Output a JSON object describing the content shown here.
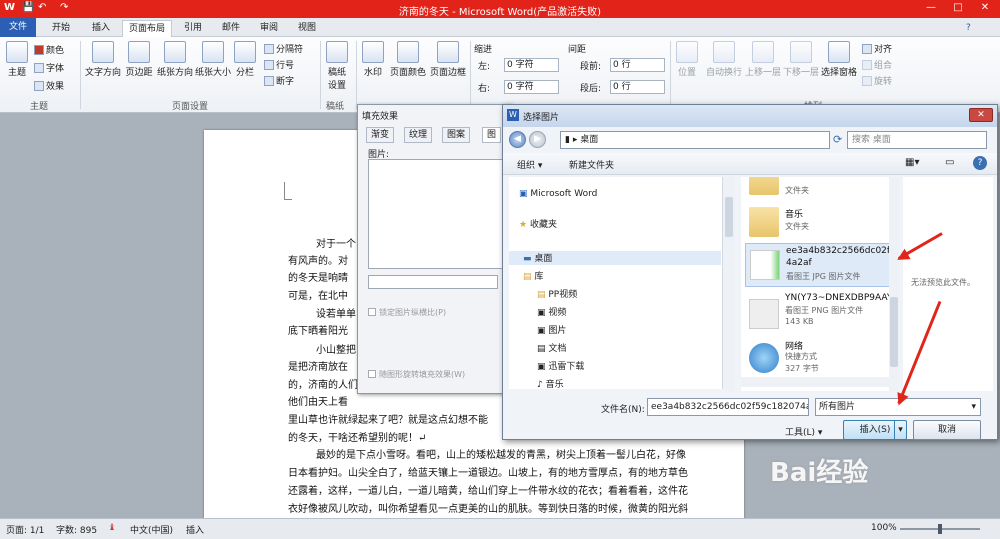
{
  "app": {
    "title": "济南的冬天 - Microsoft Word(产品激活失败)",
    "quick_access": [
      "W",
      "💾",
      "↶",
      "↷"
    ],
    "window_controls": [
      "—",
      "□",
      "✕"
    ],
    "help": "?"
  },
  "tabs": [
    "文件",
    "开始",
    "插入",
    "页面布局",
    "引用",
    "邮件",
    "审阅",
    "视图"
  ],
  "ribbon": {
    "theme": {
      "main": "主题",
      "colors": "颜色",
      "fonts": "字体",
      "effects": "效果",
      "group": "主题"
    },
    "page_setup": {
      "buttons": [
        "文字方向",
        "页边距",
        "纸张方向",
        "纸张大小",
        "分栏"
      ],
      "breaks": "分隔符",
      "line_numbers": "行号",
      "hyphenation": "断字",
      "group": "页面设置"
    },
    "draft": {
      "button": "稿纸设置",
      "group": "稿纸"
    },
    "background": {
      "buttons": [
        "水印",
        "页面颜色",
        "页面边框"
      ],
      "group": "页面背景"
    },
    "indent": {
      "title": "缩进",
      "left_label": "左:",
      "left": "0 字符",
      "right_label": "右:",
      "right": "0 字符"
    },
    "spacing": {
      "title": "间距",
      "before_label": "段前:",
      "before": "0 行",
      "after_label": "段后:",
      "after": "0 行"
    },
    "paragraph_group": "段落",
    "arrange": {
      "buttons": [
        "位置",
        "自动换行",
        "上移一层",
        "下移一层",
        "选择窗格"
      ],
      "align": "对齐",
      "group_btn": "组合",
      "rotate": "旋转",
      "group": "排列"
    }
  },
  "document": {
    "lines": [
      "对于一个",
      "有风声的。对",
      "的冬天是响晴",
      "可是，在北中",
      "设若单单",
      "底下晒着阳光",
      "小山整把",
      "是把济南放在",
      "的，济南的人们",
      "他们由天上看",
      "里山草也许就绿起来了吧？就是这点幻想不能",
      "的冬天，干啥还希望别的呢！↵",
      "最妙的是下点小雪呀。看吧，山上的矮松越发的青黑，树尖上顶着一髻儿白花，好像",
      "日本看护妇。山尖全白了，给蓝天镶上一道银边。山坡上，有的地方雪厚点，有的地方草色",
      "还露着，这样，一道儿白，一道儿暗黄，给山们穿上一件带水纹的花衣；看着看着，这件花",
      "衣好像被风儿吹动，叫你希望看见一点更美的山的肌肤。等到快日落的时候，微黄的阳光斜"
    ]
  },
  "fill_dialog": {
    "title": "填充效果",
    "tabs": [
      "渐变",
      "纹理",
      "图案",
      "图"
    ],
    "picture_label": "图片:",
    "lock_ratio": "锁定图片纵横比(P)",
    "rotate_with_shape": "随图形旋转填充效果(W)"
  },
  "pic_dialog": {
    "title": "选择图片",
    "address": "桌面",
    "search_placeholder": "搜索 桌面",
    "toolbar": {
      "organize": "组织 ▾",
      "new_folder": "新建文件夹"
    },
    "nav": [
      "Microsoft Word",
      "收藏夹",
      "桌面",
      "库",
      "PP视频",
      "视频",
      "图片",
      "文档",
      "迅雷下载",
      "音乐"
    ],
    "files": [
      {
        "name": "",
        "type": "文件夹",
        "size": ""
      },
      {
        "name": "音乐",
        "type": "文件夹",
        "size": ""
      },
      {
        "name": "ee3a4b832c2566dc02f5",
        "name2": "4a2af",
        "type": "看图王 JPG 图片文件",
        "size": ""
      },
      {
        "name": "YN(Y73~DNEXDBP9AAY",
        "name2": "",
        "type": "看图王 PNG 图片文件",
        "size": "143 KB"
      },
      {
        "name": "网络",
        "name2": "",
        "type": "快捷方式",
        "size": "327 字节"
      }
    ],
    "preview_text": "无法预览此文件。",
    "filename_label": "文件名(N):",
    "filename": "ee3a4b832c2566dc02f59c182074a2af",
    "filetype": "所有图片",
    "tools": "工具(L)",
    "insert": "插入(S)",
    "cancel": "取消"
  },
  "status": {
    "page": "页面: 1/1",
    "words": "字数: 895",
    "lang": "中文(中国)",
    "mode": "插入",
    "zoom": "100%"
  },
  "watermark": "Bai经验"
}
